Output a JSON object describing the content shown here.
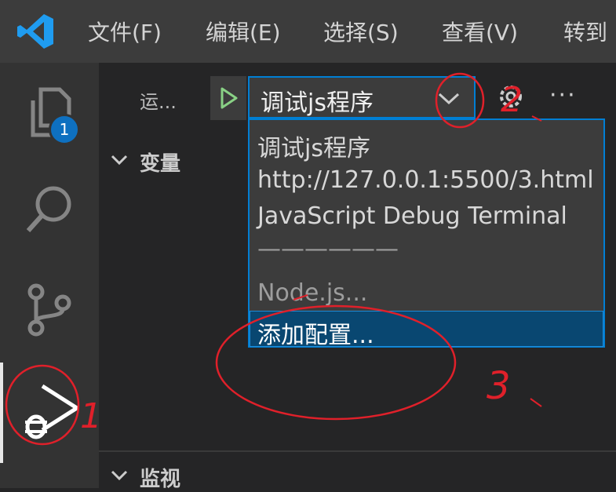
{
  "menubar": {
    "logo_icon": "vscode-logo-icon",
    "items": [
      "文件(F)",
      "编辑(E)",
      "选择(S)",
      "查看(V)",
      "转到"
    ]
  },
  "activity": {
    "explorer_badge": "1",
    "icons": [
      "files-icon",
      "search-icon",
      "source-control-icon",
      "run-debug-icon"
    ]
  },
  "run_panel": {
    "label": "运...",
    "selected_config": "调试js程序",
    "more_label": "···",
    "options": [
      "调试js程序",
      "http://127.0.0.1:5500/3.html",
      "JavaScript Debug Terminal",
      "——————",
      "Node.js...",
      "添加配置..."
    ]
  },
  "sections": {
    "variables": "变量",
    "watch": "监视"
  },
  "annotations": {
    "mark_1": "1",
    "mark_2": "2",
    "mark_3": "3"
  },
  "colors": {
    "accent": "#007fd4",
    "selected_bg": "#094771",
    "play_green": "#89d185",
    "annotation_red": "#e0202a"
  }
}
